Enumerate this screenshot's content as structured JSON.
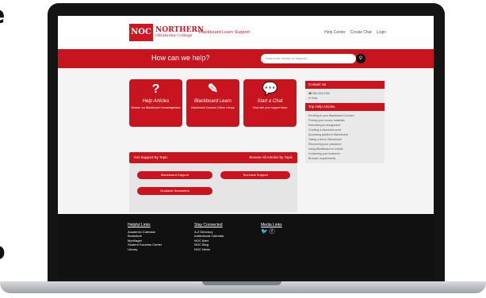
{
  "outside": {
    "side_top": "e",
    "side_bottom": "o"
  },
  "header": {
    "logo_mark": "NOC",
    "logo_line1": "NORTHERN",
    "logo_line2": "Oklahoma College",
    "site_name": "Blackboard Learn Support",
    "links": [
      "Help Center",
      "Create Chat",
      "Login"
    ]
  },
  "hero": {
    "title": "How can we help?",
    "search_placeholder": "Search for phrase or keyword",
    "search_icon": "search-icon"
  },
  "cards": [
    {
      "icon": "question-icon",
      "glyph": "?",
      "title": "Help Articles",
      "desc": "Browse our Blackboard Knowledgebase"
    },
    {
      "icon": "pencil-icon",
      "glyph": "✎",
      "title": "Blackboard Learn",
      "desc": "Blackboard Courses Online Library"
    },
    {
      "icon": "chat-icon",
      "glyph": "💬",
      "title": "Start a Chat",
      "desc": "Chat with your support team"
    }
  ],
  "support_topic": {
    "heading": "Get Support By Topic",
    "browse": "Browse All Articles by Topic",
    "pills": [
      "Blackboard Support",
      "Technical Support",
      "Gradable Semesters"
    ]
  },
  "contact": {
    "heading": "Contact Us",
    "phone": "580-628-6750",
    "chat": "Chat"
  },
  "top_articles": {
    "heading": "Top Help Articles",
    "items": [
      "Enrolling in your Blackboard Courses",
      "Finding your course materials",
      "Submitting an assignment",
      "Creating a discussion post",
      "Accessing grades in Blackboard",
      "Taking a test in Blackboard",
      "Recovering your password",
      "Using Blackboard on mobile",
      "Contacting your instructor",
      "Browser requirements"
    ]
  },
  "footer": {
    "col1_title": "Helpful Links",
    "col1": [
      "Academic Calendar",
      "Bookstore",
      "Myvillager",
      "Student Success Center",
      "Library"
    ],
    "col2_title": "Stay Connected",
    "col2": [
      "A-Z Directory",
      "Institutional Calendar",
      "NOC Alert",
      "NOC Blog",
      "NOC News"
    ],
    "col3_title": "Media Links",
    "col3_icons": [
      "twitter-icon",
      "facebook-icon"
    ]
  }
}
